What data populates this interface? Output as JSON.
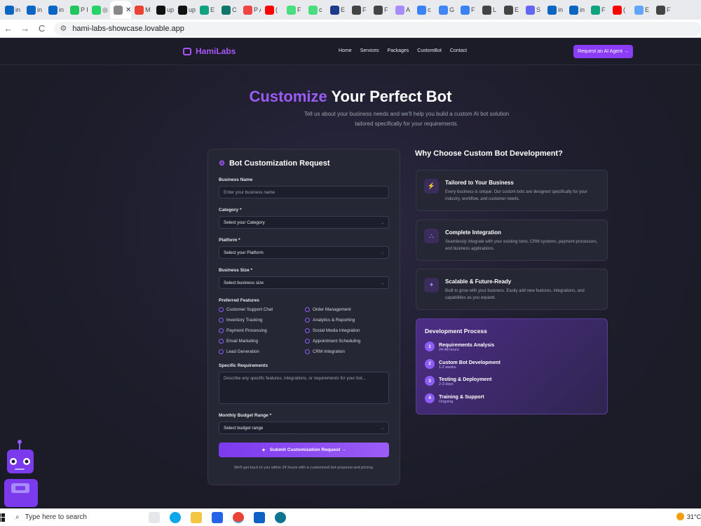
{
  "browser": {
    "tabs": [
      {
        "label": "in (",
        "color": "#0a66c2"
      },
      {
        "label": "in I",
        "color": "#0a66c2"
      },
      {
        "label": "in (",
        "color": "#0a66c2"
      },
      {
        "label": "P F",
        "color": "#22c55e"
      },
      {
        "label": "◎ (",
        "color": "#25d366"
      },
      {
        "label": "I",
        "color": "#888888",
        "active": true
      },
      {
        "label": "M Y",
        "color": "#ea4335"
      },
      {
        "label": "up F",
        "color": "#111111"
      },
      {
        "label": "up Y",
        "color": "#111111"
      },
      {
        "label": "E",
        "color": "#10a37f"
      },
      {
        "label": "C",
        "color": "#0f766e"
      },
      {
        "label": "P A",
        "color": "#ef4444"
      },
      {
        "label": "(",
        "color": "#ff0000"
      },
      {
        "label": "F",
        "color": "#4ade80"
      },
      {
        "label": "c",
        "color": "#4ade80"
      },
      {
        "label": "E",
        "color": "#1e3a8a"
      },
      {
        "label": "F",
        "color": "#444444"
      },
      {
        "label": "F",
        "color": "#444444"
      },
      {
        "label": "A",
        "color": "#a78bfa"
      },
      {
        "label": "c",
        "color": "#3b82f6"
      },
      {
        "label": "G t",
        "color": "#4285f4"
      },
      {
        "label": "F",
        "color": "#3b82f6"
      },
      {
        "label": "L",
        "color": "#444444"
      },
      {
        "label": "E",
        "color": "#444444"
      },
      {
        "label": "S",
        "color": "#6366f1"
      },
      {
        "label": "in F",
        "color": "#0a66c2"
      },
      {
        "label": "in F",
        "color": "#0a66c2"
      },
      {
        "label": "F",
        "color": "#10a37f"
      },
      {
        "label": "(",
        "color": "#ff0000"
      },
      {
        "label": "E",
        "color": "#60a5fa"
      },
      {
        "label": "F",
        "color": "#444444"
      }
    ],
    "active_close": "✕",
    "back": "←",
    "forward": "→",
    "reload": "C",
    "url": "hami-labs-showcase.lovable.app"
  },
  "site": {
    "logo": "HamiLabs",
    "nav": [
      "Home",
      "Services",
      "Packages",
      "CustomBot",
      "Contact"
    ],
    "cta": "Request an AI Agent →",
    "hero_highlight": "Customize",
    "hero_rest": " Your Perfect Bot",
    "hero_sub": "Tell us about your business needs and we'll help you build a custom AI bot solution tailored specifically for your requirements."
  },
  "form": {
    "title": "Bot Customization Request",
    "business_name_label": "Business Name",
    "business_name_placeholder": "Enter your business name",
    "category_label": "Category *",
    "category_value": "Select your Category",
    "platform_label": "Platform *",
    "platform_value": "Select your Platform",
    "size_label": "Business Size *",
    "size_value": "Select business size",
    "features_label": "Preferred Features",
    "features": [
      "Customer Support Chat",
      "Order Management",
      "Inventory Tracking",
      "Analytics & Reporting",
      "Payment Processing",
      "Social Media Integration",
      "Email Marketing",
      "Appointment Scheduling",
      "Lead Generation",
      "CRM Integration"
    ],
    "requirements_label": "Specific Requirements",
    "requirements_placeholder": "Describe any specific features, integrations, or requirements for your bot...",
    "budget_label": "Monthly Budget Range *",
    "budget_value": "Select budget range",
    "submit": "Submit Customization Request →",
    "note": "We'll get back to you within 24 hours with a customized bot proposal and pricing."
  },
  "why": {
    "title": "Why Choose Custom Bot Development?",
    "cards": [
      {
        "icon": "lightning-icon",
        "glyph": "⚡",
        "title": "Tailored to Your Business",
        "desc": "Every business is unique. Our custom bots are designed specifically for your industry, workflow, and customer needs."
      },
      {
        "icon": "network-icon",
        "glyph": "⛬",
        "title": "Complete Integration",
        "desc": "Seamlessly integrate with your existing tools, CRM systems, payment processors, and business applications."
      },
      {
        "icon": "sparkle-icon",
        "glyph": "✦",
        "title": "Scalable & Future-Ready",
        "desc": "Built to grow with your business. Easily add new features, integrations, and capabilities as you expand."
      }
    ]
  },
  "process": {
    "title": "Development Process",
    "steps": [
      {
        "n": "1",
        "title": "Requirements Analysis",
        "time": "24-48 hours"
      },
      {
        "n": "2",
        "title": "Custom Bot Development",
        "time": "1-2 weeks"
      },
      {
        "n": "3",
        "title": "Testing & Deployment",
        "time": "2-3 days"
      },
      {
        "n": "4",
        "title": "Training & Support",
        "time": "Ongoing"
      }
    ]
  },
  "taskbar": {
    "search_placeholder": "Type here to search",
    "weather": "31°C"
  }
}
